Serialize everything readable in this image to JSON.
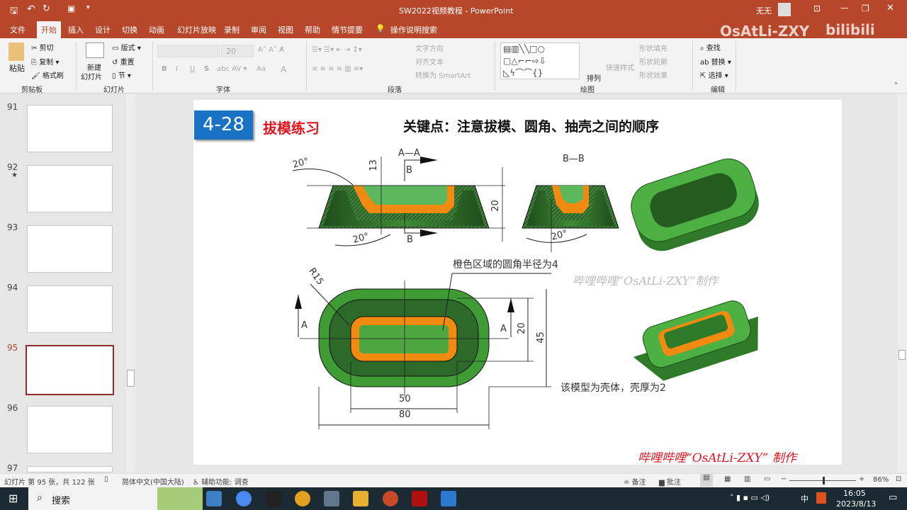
{
  "titlebar": {
    "title": "SW2022视频教程 - PowerPoint",
    "user": "无无",
    "watermark": "OsAtLi-ZXY"
  },
  "tabs": [
    "文件",
    "开始",
    "插入",
    "设计",
    "切换",
    "动画",
    "幻灯片放映",
    "录制",
    "审阅",
    "视图",
    "帮助",
    "情节提要",
    "操作说明搜索"
  ],
  "ribbon": {
    "clipboard": {
      "paste": "粘贴",
      "cut": "剪切",
      "copy": "复制",
      "format_painter": "格式刷",
      "label": "剪贴板"
    },
    "slides": {
      "new_slide_1": "新建",
      "new_slide_2": "幻灯片",
      "layout": "版式",
      "reset": "重置",
      "section": "节",
      "label": "幻灯片"
    },
    "font": {
      "size": "20",
      "label": "字体",
      "bold": "B",
      "italic": "I",
      "underline": "U",
      "shadow": "S",
      "aa": "Aa",
      "color_a": "A"
    },
    "paragraph": {
      "text_direction": "文字方向",
      "align_text": "对齐文本",
      "smartart": "转换为 SmartArt",
      "label": "段落"
    },
    "drawing": {
      "arrange": "排列",
      "quick_styles": "快速样式",
      "shape_fill": "形状填充",
      "shape_outline": "形状轮廓",
      "shape_effects": "形状效果",
      "label": "绘图"
    },
    "editing": {
      "find": "查找",
      "replace": "替换",
      "select": "选择",
      "label": "编辑"
    }
  },
  "thumbnails": [
    {
      "num": "91"
    },
    {
      "num": "92",
      "star": "★"
    },
    {
      "num": "93"
    },
    {
      "num": "94"
    },
    {
      "num": "95",
      "selected": true
    },
    {
      "num": "96"
    },
    {
      "num": "97"
    }
  ],
  "slide": {
    "badge": "4-28",
    "title": "拔模练习",
    "key_point": "关键点：注意拔模、圆角、抽壳之间的顺序",
    "section_aa": "A—A",
    "section_bb": "B—B",
    "b_label": "B",
    "a_label": "A",
    "dim_13": "13",
    "dim_20": "20",
    "angle_20": "20°",
    "r15": "R15",
    "note_fillet": "橙色区域的圆角半径为4",
    "dim_45": "45",
    "dim_50": "50",
    "dim_80": "80",
    "note_shell": "该模型为壳体，壳厚为2",
    "watermark": "哔哩哔哩“OsAtLi-ZXY”制作",
    "footer": "哔哩哔哩“OsAtLi-ZXY” 制作"
  },
  "status": {
    "slide_info": "幻灯片 第 95 张，共 122 张",
    "language": "简体中文(中国大陆)",
    "accessibility": "辅助功能: 调查",
    "notes": "备注",
    "comments": "批注",
    "zoom": "86%",
    "zoom_fraction": 0.5
  },
  "taskbar": {
    "search": "搜索",
    "time": "16:05",
    "date": "2023/8/13",
    "ime": "中"
  },
  "colors": {
    "accent": "#b7472a",
    "green": "#3f9c35",
    "dark_green": "#2d6a2a",
    "orange": "#f08a10",
    "badge_blue": "#1a72c4",
    "red_text": "#e0141e"
  }
}
